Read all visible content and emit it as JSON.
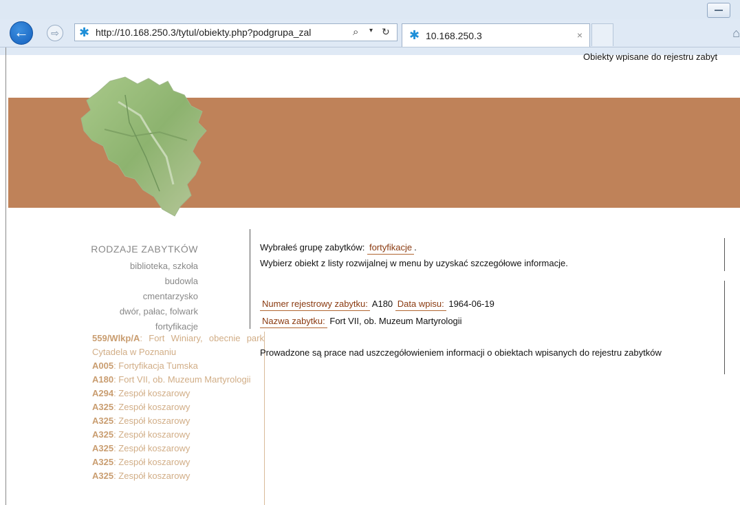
{
  "browser": {
    "address": "http://10.168.250.3/tytul/obiekty.php?podgrupa_zal",
    "tab_title": "10.168.250.3",
    "tab_close": "×",
    "back": "←",
    "forward": "⇨",
    "search_glyph": "⌕",
    "drop_glyph": "▾",
    "refresh_glyph": "↻"
  },
  "header": {
    "right_text": "Obiekty wpisane do rejestru zabyt"
  },
  "sidebar": {
    "title": "RODZAJE ZABYTKÓW",
    "categories": [
      "biblioteka, szkoła",
      "budowla",
      "cmentarzysko",
      "dwór, pałac, folwark",
      "fortyfikacje"
    ],
    "objects": [
      {
        "code": "559/Wlkp/A",
        "name": ": Fort Winiary, obecnie park Cytadela w Poznaniu"
      },
      {
        "code": "A005",
        "name": ": Fortyfikacja Tumska"
      },
      {
        "code": "A180",
        "name": ": Fort VII, ob. Muzeum Martyrologii"
      },
      {
        "code": "A294",
        "name": ": Zespół koszarowy"
      },
      {
        "code": "A325",
        "name": ": Zespół koszarowy"
      },
      {
        "code": "A325",
        "name": ": Zespół koszarowy"
      },
      {
        "code": "A325",
        "name": ": Zespół koszarowy"
      },
      {
        "code": "A325",
        "name": ": Zespół koszarowy"
      },
      {
        "code": "A325",
        "name": ": Zespół koszarowy"
      },
      {
        "code": "A325",
        "name": ": Zespół koszarowy"
      }
    ]
  },
  "main": {
    "selected_prefix": "Wybrałeś grupę zabytków:",
    "selected_group": "fortyfikacje",
    "selected_suffix": ".",
    "instruction": "Wybierz obiekt z listy rozwijalnej w menu by uzyskać szczegółowe informacje.",
    "reg_label": "Numer rejestrowy zabytku:",
    "reg_value": "A180",
    "date_label": "Data wpisu:",
    "date_value": "1964-06-19",
    "name_label": "Nazwa zabytku:",
    "name_value": "Fort VII, ob. Muzeum Martyrologii",
    "note": "Prowadzone są prace nad uszczegółowieniem informacji o obiektach wpisanych do rejestru zabytków"
  },
  "colors": {
    "banner": "#bf8259",
    "link_brown": "#8a3a10",
    "list_text": "#d1ad86"
  }
}
